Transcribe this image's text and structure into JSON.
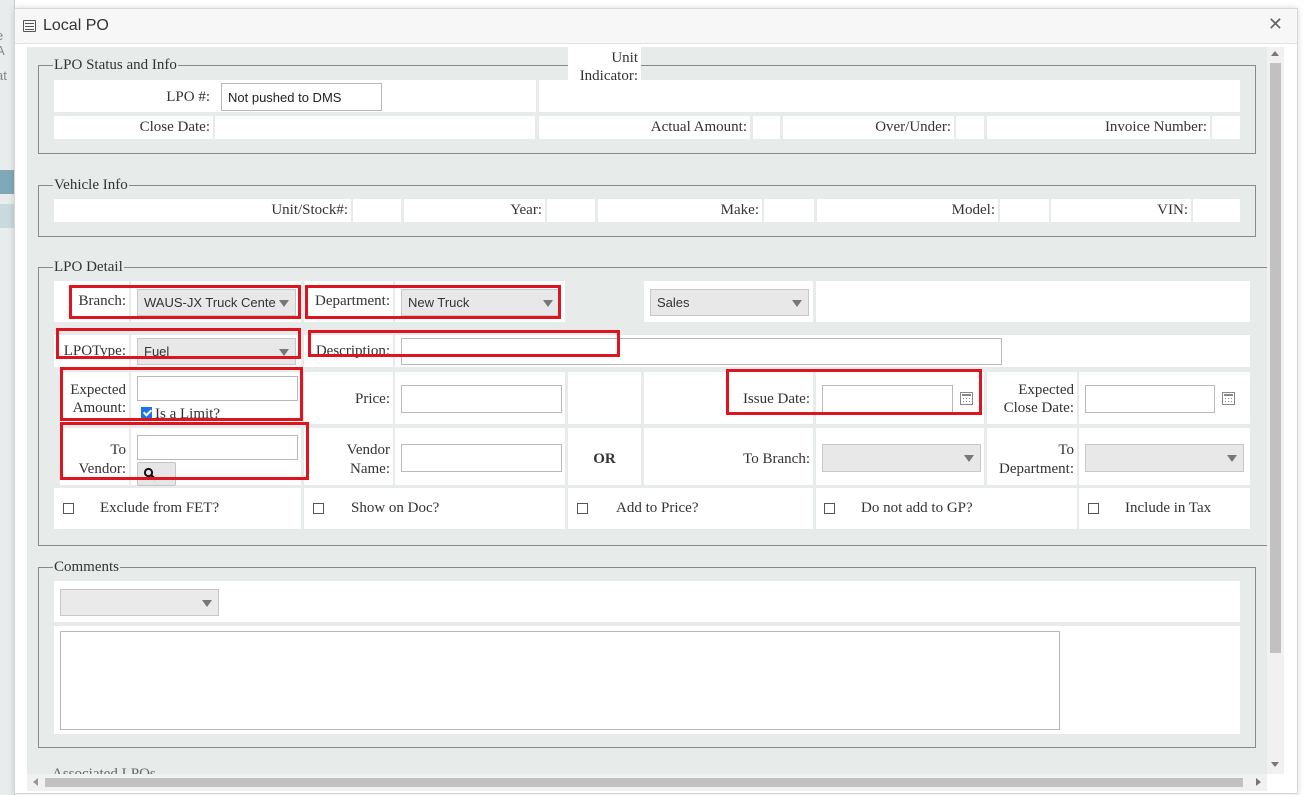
{
  "window": {
    "title": "Local PO",
    "close_glyph": "✕"
  },
  "background": {
    "fragment_1": "e A",
    "fragment_2": "at"
  },
  "status_info": {
    "legend": "LPO Status and Info",
    "lpo_label": "LPO #:",
    "lpo_value": "Not pushed to DMS",
    "close_date_label": "Close Date:",
    "actual_amount_label": "Actual Amount:",
    "over_under_label": "Over/Under:",
    "invoice_number_label": "Invoice Number:"
  },
  "vehicle_info": {
    "legend": "Vehicle Info",
    "unit_stock_label": "Unit/Stock#:",
    "year_label": "Year:",
    "make_label": "Make:",
    "model_label": "Model:",
    "vin_label": "VIN:"
  },
  "lpo_detail": {
    "legend": "LPO Detail",
    "branch_label": "Branch:",
    "branch_value": "WAUS-JX Truck Cente",
    "department_label": "Department:",
    "department_value": "New Truck",
    "unit_indicator_label_1": "Unit",
    "unit_indicator_label_2": "Indicator:",
    "unit_indicator_value": "Sales",
    "lpotype_label": "LPOType:",
    "lpotype_value": "Fuel",
    "description_label": "Description:",
    "expected_amount_label_1": "Expected",
    "expected_amount_label_2": "Amount:",
    "is_limit_label": "Is a Limit?",
    "is_limit_checked": true,
    "price_label": "Price:",
    "issue_date_label": "Issue Date:",
    "expected_close_label_1": "Expected",
    "expected_close_label_2": "Close Date:",
    "to_vendor_label_1": "To",
    "to_vendor_label_2": "Vendor:",
    "vendor_name_label_1": "Vendor",
    "vendor_name_label_2": "Name:",
    "or_label": "OR",
    "to_branch_label": "To Branch:",
    "to_department_label_1": "To",
    "to_department_label_2": "Department:",
    "checkboxes": [
      {
        "label": "Exclude from FET?",
        "checked": false
      },
      {
        "label": "Show on Doc?",
        "checked": false
      },
      {
        "label": "Add to Price?",
        "checked": false
      },
      {
        "label": "Do not add to GP?",
        "checked": false
      },
      {
        "label": "Include in Tax",
        "checked": false
      }
    ]
  },
  "comments": {
    "legend": "Comments",
    "partial_next_legend": "Associated LPOs"
  },
  "colors": {
    "highlight": "#e0141e",
    "panel_bg": "#e7ebea",
    "checkbox_accent": "#1a73e8"
  },
  "icons": [
    "close-icon",
    "window-icon",
    "calendar-icon",
    "search-icon",
    "dropdown-arrow-icon"
  ]
}
